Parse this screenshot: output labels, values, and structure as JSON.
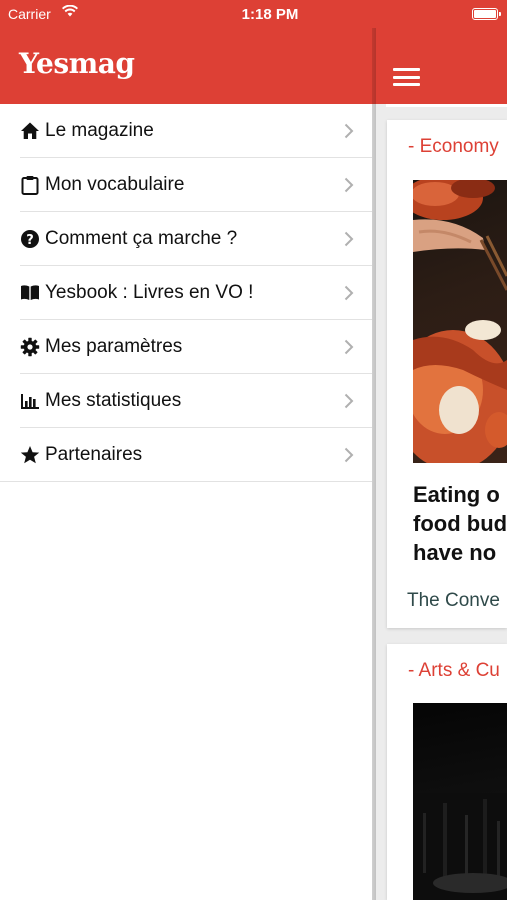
{
  "status_bar": {
    "carrier": "Carrier",
    "time": "1:18 PM"
  },
  "drawer": {
    "brand": "Yesmag",
    "items": [
      {
        "label": "Le magazine",
        "icon": "home-icon"
      },
      {
        "label": "Mon vocabulaire",
        "icon": "clipboard-icon"
      },
      {
        "label": "Comment ça marche ?",
        "icon": "question-circle-icon"
      },
      {
        "label": "Yesbook : Livres en VO !",
        "icon": "book-icon"
      },
      {
        "label": "Mes paramètres",
        "icon": "gear-icon"
      },
      {
        "label": "Mes statistiques",
        "icon": "bar-chart-icon"
      },
      {
        "label": "Partenaires",
        "icon": "star-icon"
      }
    ]
  },
  "feed": {
    "articles": [
      {
        "category": "- Economy",
        "headline": "Eating o\nfood bud\nhave no",
        "source": "The Conve"
      },
      {
        "category": "- Arts & Cu"
      }
    ]
  },
  "colors": {
    "brand_red": "#dd4035",
    "feed_background": "#ececec"
  }
}
